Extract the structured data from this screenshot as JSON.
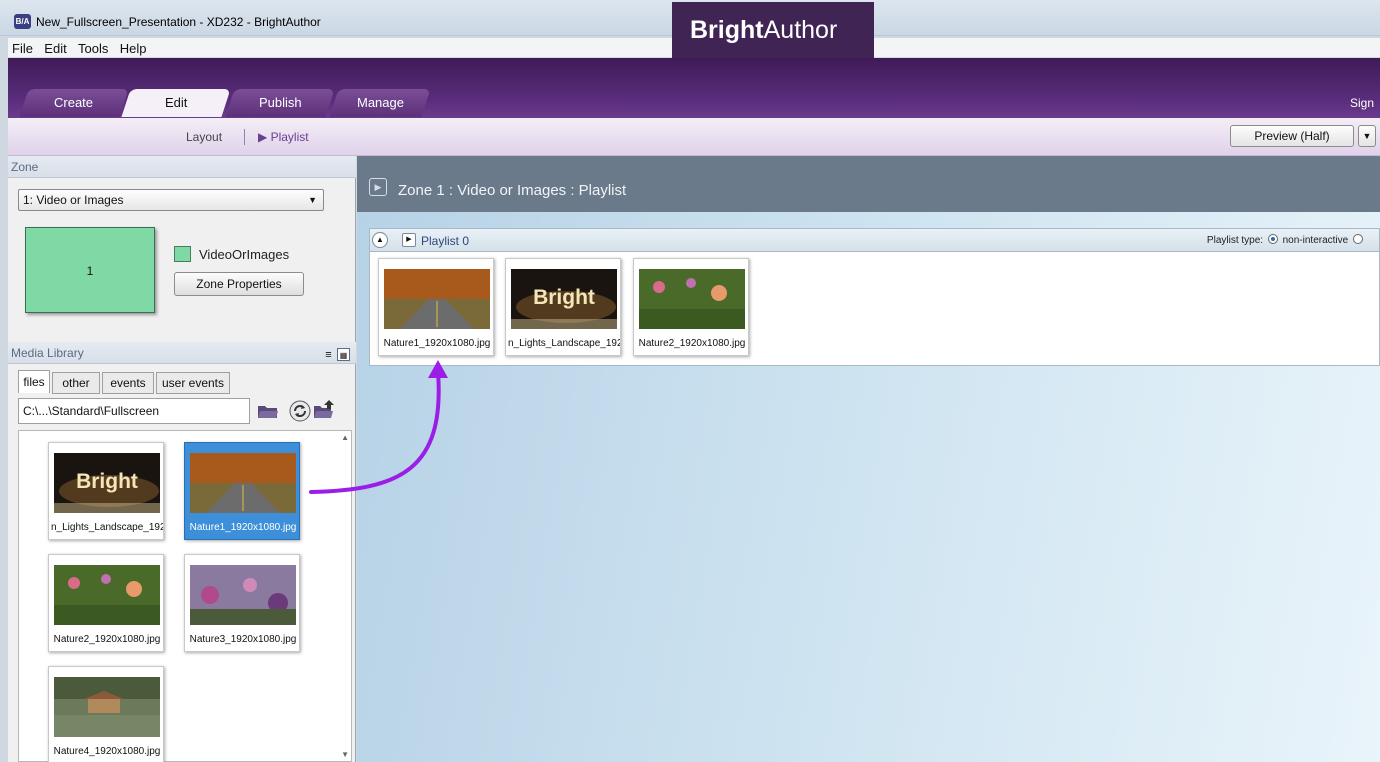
{
  "window": {
    "title": "New_Fullscreen_Presentation - XD232 - BrightAuthor",
    "icon_text": "B/A"
  },
  "menu": [
    "File",
    "Edit",
    "Tools",
    "Help"
  ],
  "header": {
    "brand_bold": "Bright",
    "brand_thin": "Author",
    "sign": "Sign",
    "tabs": [
      "Create",
      "Edit",
      "Publish",
      "Manage"
    ],
    "active_tab": "Edit"
  },
  "subbar": {
    "layout": "Layout",
    "playlist": "▶ Playlist",
    "preview": "Preview (Half)"
  },
  "zone_panel": {
    "heading": "Zone",
    "selected_zone": "1: Video or Images",
    "zone_number": "1",
    "zone_type_label": "VideoOrImages",
    "zone_properties_button": "Zone Properties"
  },
  "media_library": {
    "heading": "Media Library",
    "tabs": [
      "files",
      "other",
      "events",
      "user events"
    ],
    "active_tab": "files",
    "path": "C:\\...\\Standard\\Fullscreen",
    "files": [
      {
        "name": "n_Lights_Landscape_192(",
        "image": "bright",
        "selected": false
      },
      {
        "name": "Nature1_1920x1080.jpg",
        "image": "road",
        "selected": true
      },
      {
        "name": "Nature2_1920x1080.jpg",
        "image": "flowers",
        "selected": false
      },
      {
        "name": "Nature3_1920x1080.jpg",
        "image": "purple",
        "selected": false
      },
      {
        "name": "Nature4_1920x1080.jpg",
        "image": "gazebo",
        "selected": false
      }
    ]
  },
  "main": {
    "zone_header": "Zone 1 : Video or Images : Playlist",
    "playlist_name": "Playlist 0",
    "playlist_type_label": "Playlist type:",
    "playlist_type_value": "non-interactive",
    "playlist_items": [
      {
        "name": "Nature1_1920x1080.jpg",
        "image": "road"
      },
      {
        "name": "n_Lights_Landscape_192(",
        "image": "bright"
      },
      {
        "name": "Nature2_1920x1080.jpg",
        "image": "flowers"
      }
    ]
  },
  "colors": {
    "header_purple": "#5a2d7c",
    "zone_green": "#7fd9a5",
    "arrow_purple": "#9b1ee6",
    "selection_blue": "#3d8fd9"
  }
}
